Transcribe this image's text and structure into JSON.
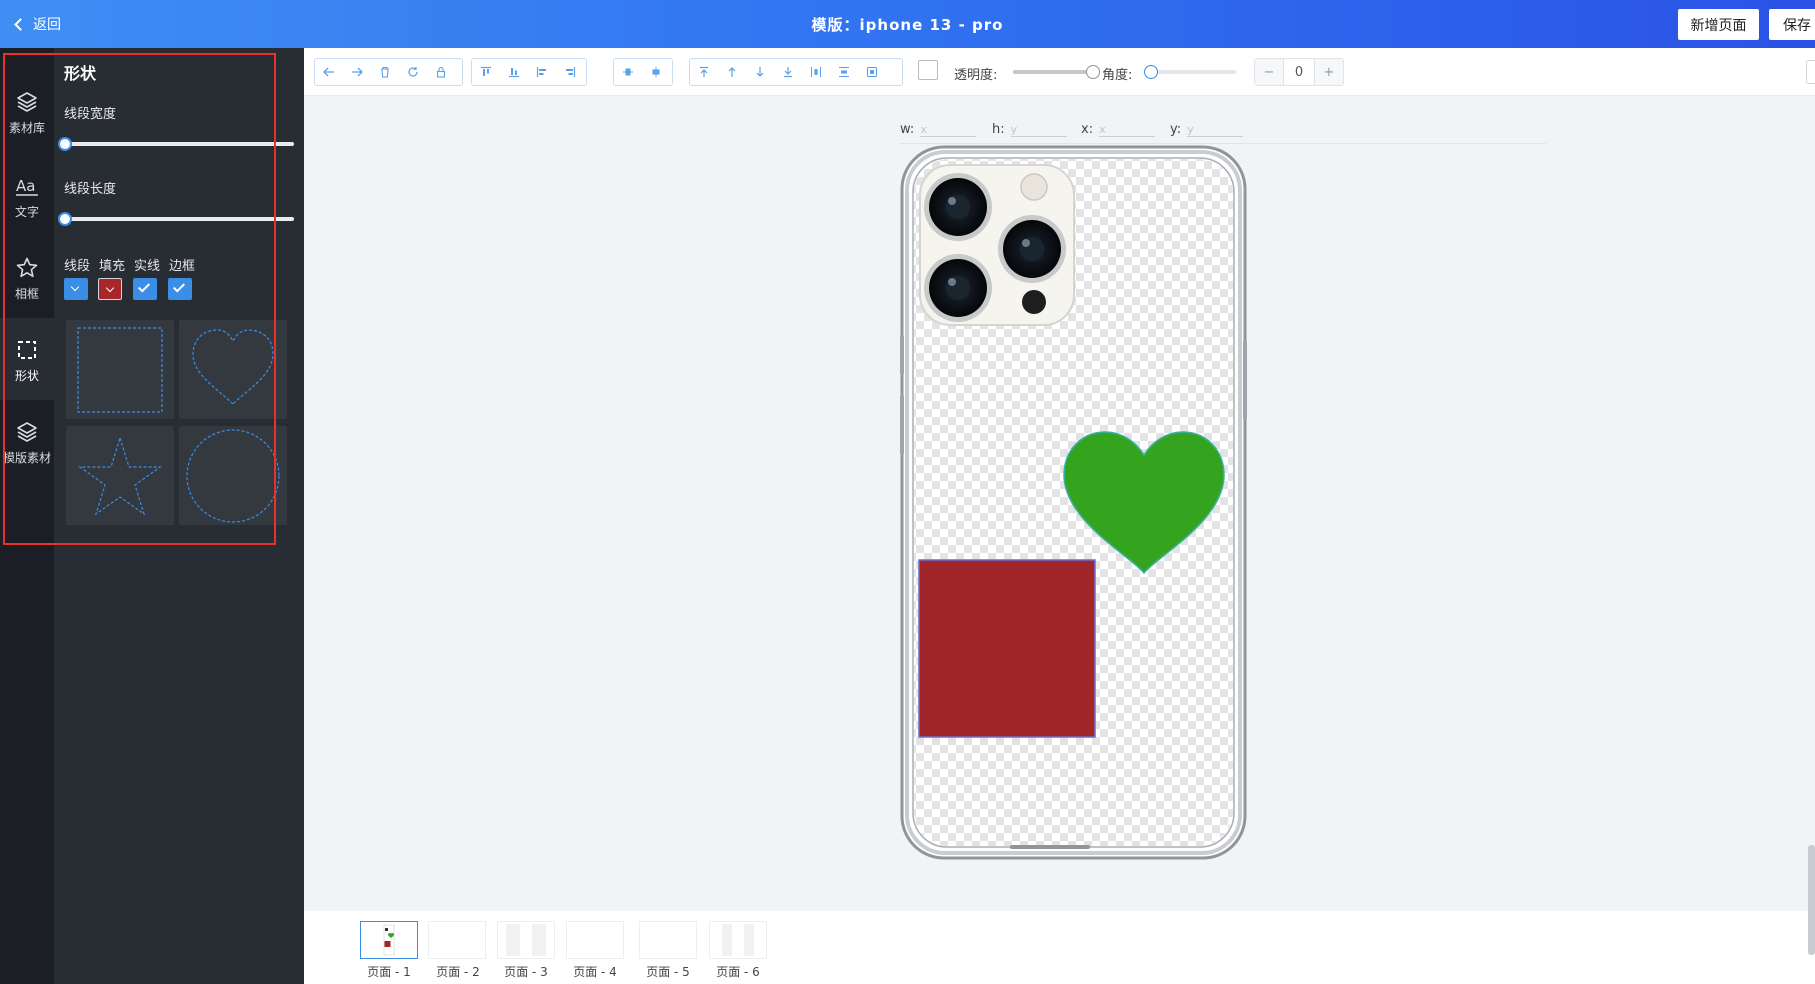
{
  "header": {
    "back_label": "返回",
    "title": "模版：iphone 13 - pro",
    "add_page_label": "新增页面",
    "save_label": "保存"
  },
  "rail": {
    "items": [
      {
        "label": "素材库",
        "icon": "layers-icon"
      },
      {
        "label": "文字",
        "icon": "text-aa-icon"
      },
      {
        "label": "相框",
        "icon": "star-icon"
      },
      {
        "label": "形状",
        "icon": "dashed-square-icon",
        "active": true
      },
      {
        "label": "模版素材",
        "icon": "layers-icon"
      }
    ]
  },
  "panel": {
    "title": "形状",
    "line_width_label": "线段宽度",
    "line_width_value": 0,
    "line_length_label": "线段长度",
    "line_length_value": 0,
    "options": [
      {
        "label": "线段",
        "state": "dropdown",
        "color": "#3a8ee6"
      },
      {
        "label": "填充",
        "state": "dropdown",
        "color": "#a8262a"
      },
      {
        "label": "实线",
        "state": "checked",
        "color": "#3a8ee6"
      },
      {
        "label": "边框",
        "state": "checked",
        "color": "#3a8ee6"
      }
    ],
    "shapes": [
      "square",
      "heart",
      "star",
      "circle"
    ]
  },
  "toolbar": {
    "opacity_label": "透明度:",
    "angle_label": "角度:",
    "opacity_value": 1,
    "angle_value": 0,
    "angle_input": "0",
    "minus": "−",
    "plus": "+"
  },
  "canvas": {
    "w_label": "w:",
    "h_label": "h:",
    "x_label": "x:",
    "y_label": "y:",
    "w_placeholder": "x",
    "h_placeholder": "y",
    "x_placeholder": "x",
    "y_placeholder": "y",
    "heart_color": "#34a41f",
    "rect_color": "#a0262a"
  },
  "pages": [
    {
      "label": "页面 - 1",
      "active": true
    },
    {
      "label": "页面 - 2"
    },
    {
      "label": "页面 - 3"
    },
    {
      "label": "页面 - 4"
    },
    {
      "label": "页面 - 5"
    },
    {
      "label": "页面 - 6"
    }
  ]
}
